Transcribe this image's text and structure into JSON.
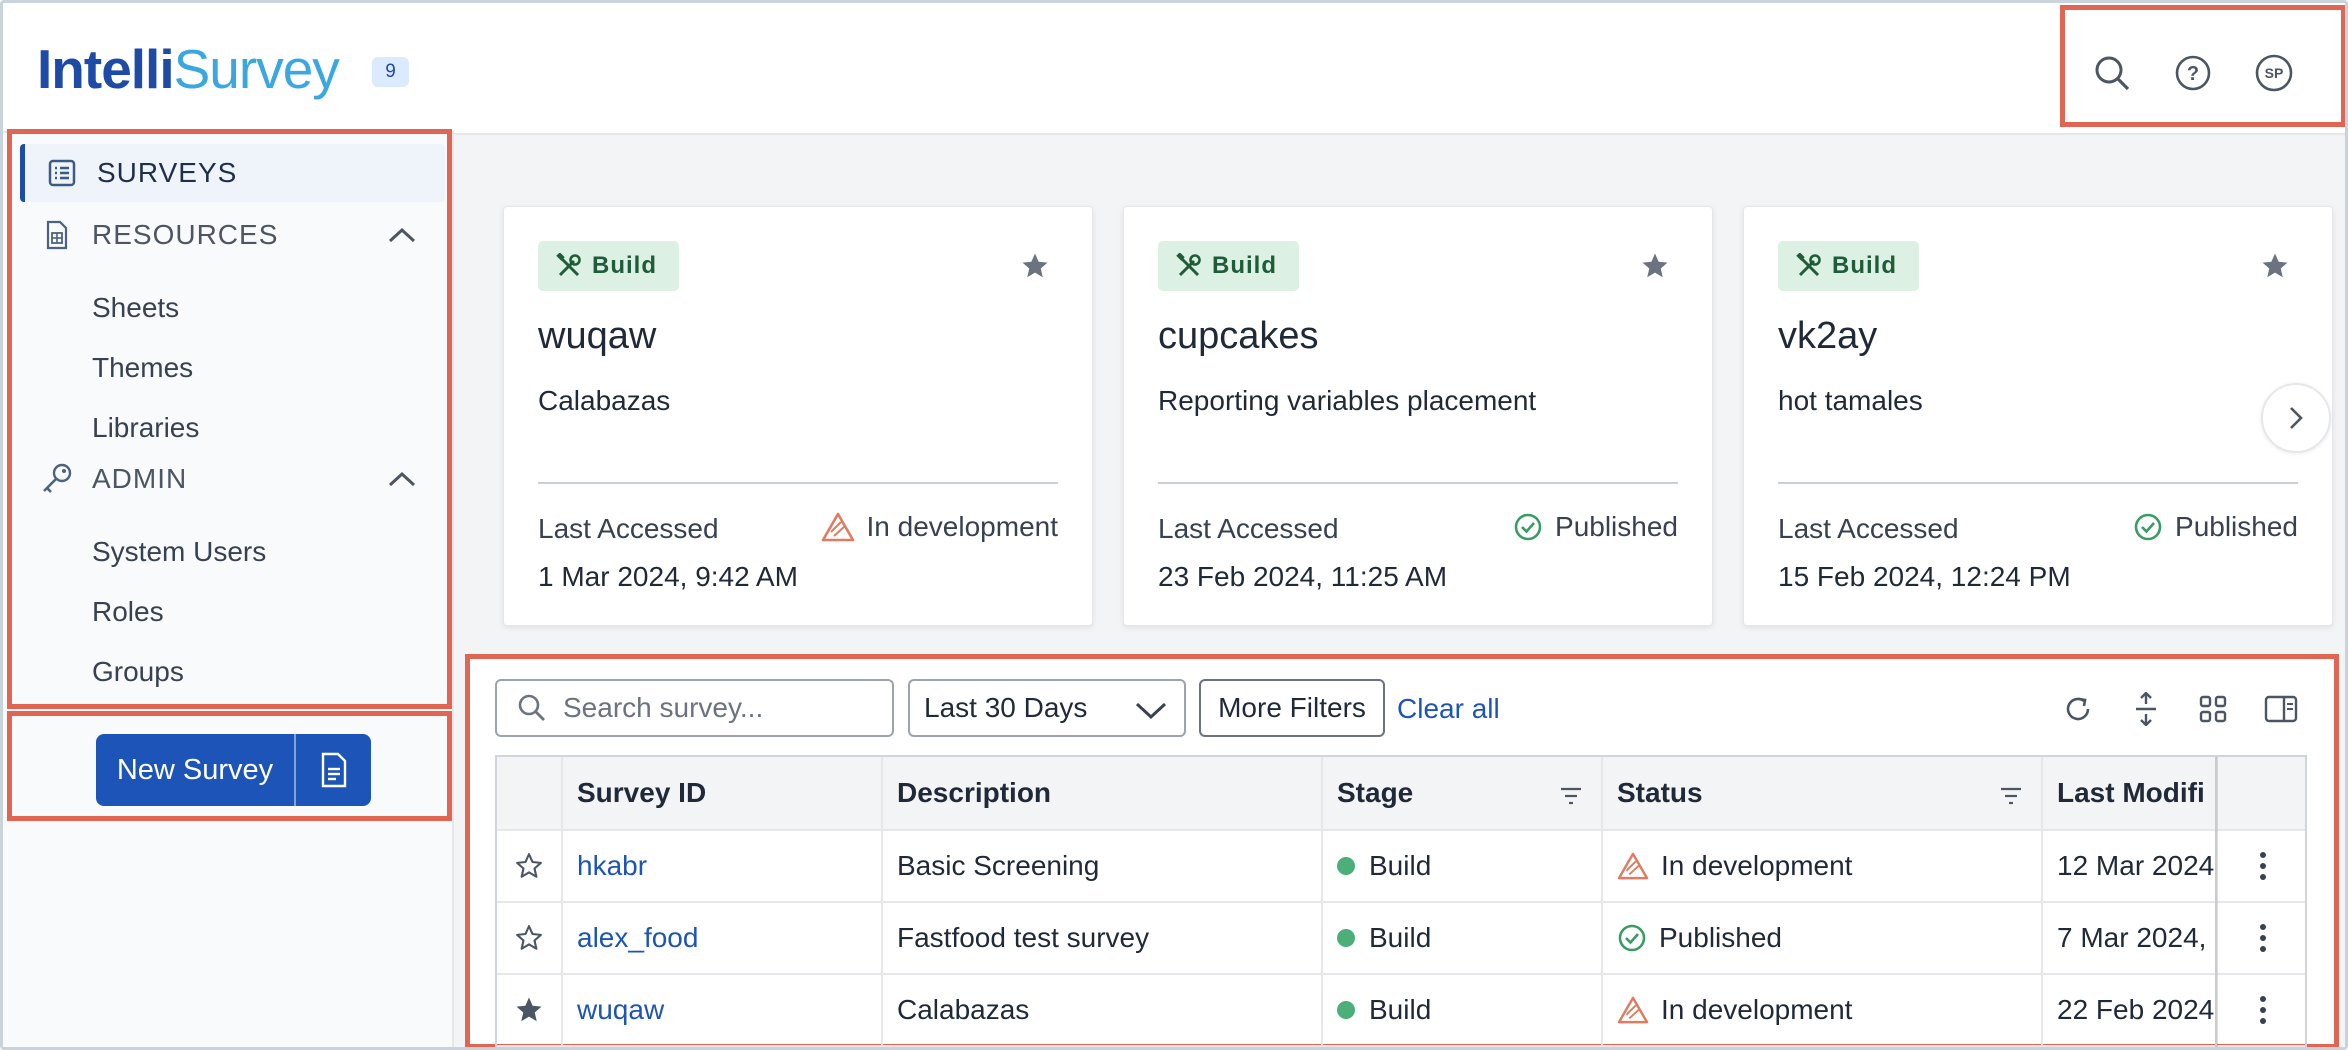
{
  "app": {
    "logo_part1": "Intelli",
    "logo_part2": "Survey",
    "version_badge": "9"
  },
  "sidebar": {
    "items": [
      {
        "label": "SURVEYS",
        "icon": "table-list-icon",
        "active": true
      },
      {
        "label": "RESOURCES",
        "icon": "sheet-icon",
        "expanded": true,
        "children": [
          "Sheets",
          "Themes",
          "Libraries"
        ]
      },
      {
        "label": "ADMIN",
        "icon": "key-icon",
        "expanded": true,
        "children": [
          "System Users",
          "Roles",
          "Groups"
        ]
      }
    ],
    "new_survey_label": "New Survey"
  },
  "header": {
    "icons": [
      "search-icon",
      "help-icon",
      "user-avatar-icon"
    ],
    "avatar_initials": "SP"
  },
  "recent_cards": [
    {
      "stage": "Build",
      "title": "wuqaw",
      "description": "Calabazas",
      "last_accessed_label": "Last Accessed",
      "date": "1 Mar 2024, 9:42 AM",
      "status": "In development",
      "status_type": "warning",
      "starred": true
    },
    {
      "stage": "Build",
      "title": "cupcakes",
      "description": "Reporting variables placement",
      "last_accessed_label": "Last Accessed",
      "date": "23 Feb 2024, 11:25 AM",
      "status": "Published",
      "status_type": "success",
      "starred": true
    },
    {
      "stage": "Build",
      "title": "vk2ay",
      "description": "hot tamales",
      "last_accessed_label": "Last Accessed",
      "date": "15 Feb 2024, 12:24 PM",
      "status": "Published",
      "status_type": "success",
      "starred": true
    }
  ],
  "toolbar": {
    "search_placeholder": "Search survey...",
    "date_range": "Last 30 Days",
    "more_filters": "More Filters",
    "clear_all": "Clear all",
    "icons": [
      "refresh-icon",
      "row-density-icon",
      "grid-view-icon",
      "column-panel-icon"
    ]
  },
  "table": {
    "columns": [
      "Survey ID",
      "Description",
      "Stage",
      "Status",
      "Last Modifi"
    ],
    "rows": [
      {
        "starred": false,
        "id": "hkabr",
        "description": "Basic Screening",
        "stage": "Build",
        "status": "In development",
        "status_type": "warning",
        "last_modified": "12 Mar 2024"
      },
      {
        "starred": false,
        "id": "alex_food",
        "description": "Fastfood test survey",
        "stage": "Build",
        "status": "Published",
        "status_type": "success",
        "last_modified": "7 Mar 2024,"
      },
      {
        "starred": true,
        "id": "wuqaw",
        "description": "Calabazas",
        "stage": "Build",
        "status": "In development",
        "status_type": "warning",
        "last_modified": "22 Feb 2024"
      }
    ]
  },
  "colors": {
    "brand_blue": "#1d54b8",
    "logo_light": "#3ba7e0",
    "annotation_red": "#e06552",
    "build_green_bg": "#dcf1e4",
    "warning_orange": "#e07b5f",
    "success_green": "#3a9b63"
  }
}
